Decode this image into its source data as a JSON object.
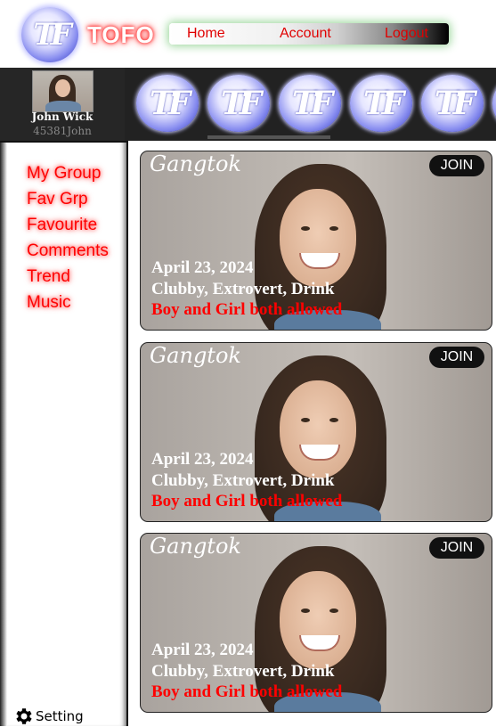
{
  "brand": {
    "logo_text": "TF",
    "name": "TOFO"
  },
  "nav": {
    "home": "Home",
    "account": "Account",
    "logout": "Logout"
  },
  "profile": {
    "name": "John Wick",
    "id": "45381John"
  },
  "stories": [
    {
      "logo_text": "TF"
    },
    {
      "logo_text": "TF"
    },
    {
      "logo_text": "TF"
    },
    {
      "logo_text": "TF"
    },
    {
      "logo_text": "TF"
    }
  ],
  "sidebar": {
    "items": [
      {
        "label": "My Group"
      },
      {
        "label": "Fav Grp"
      },
      {
        "label": "Favourite"
      },
      {
        "label": "Comments"
      },
      {
        "label": "Trend"
      },
      {
        "label": "Music"
      }
    ],
    "setting": {
      "label": "Setting",
      "icon": "gear-icon"
    }
  },
  "cards": [
    {
      "city": "Gangtok",
      "join": "JOIN",
      "date": "April 23, 2024",
      "tags": "Clubby, Extrovert, Drink",
      "rule": "Boy and Girl both allowed"
    },
    {
      "city": "Gangtok",
      "join": "JOIN",
      "date": "April 23, 2024",
      "tags": "Clubby, Extrovert, Drink",
      "rule": "Boy and Girl both allowed"
    },
    {
      "city": "Gangtok",
      "join": "JOIN",
      "date": "April 23, 2024",
      "tags": "Clubby, Extrovert, Drink",
      "rule": "Boy and Girl both allowed"
    }
  ],
  "colors": {
    "accent_red": "#ff0000",
    "dark_bar": "#232323",
    "logo_blue": "#5d63d8"
  }
}
